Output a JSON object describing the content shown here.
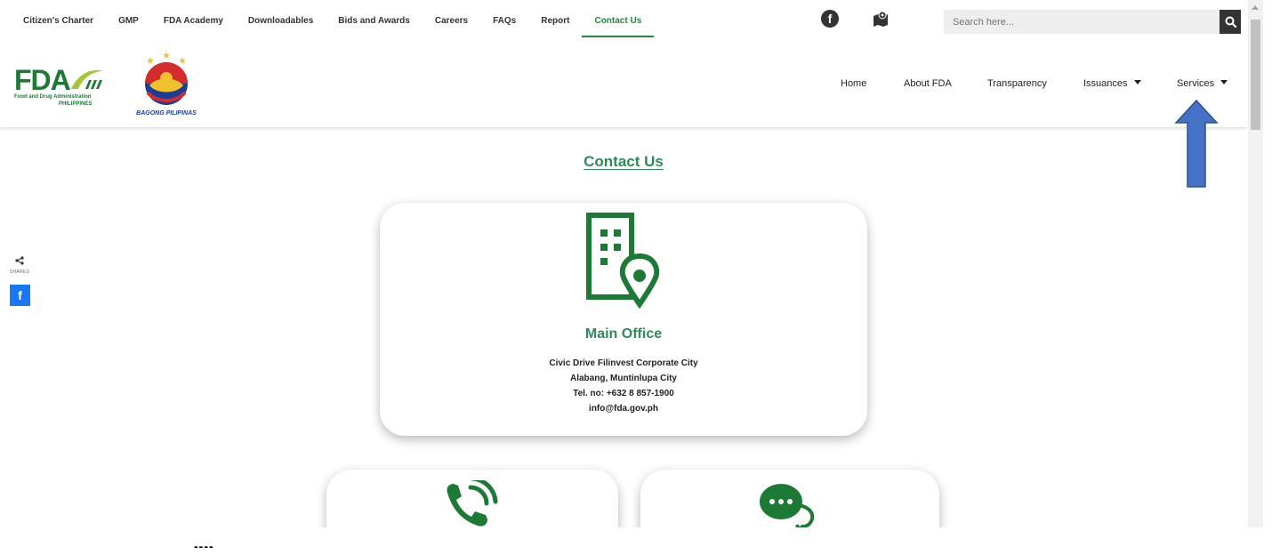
{
  "topnav": {
    "links": [
      {
        "label": "Citizen's Charter"
      },
      {
        "label": "GMP"
      },
      {
        "label": "FDA Academy"
      },
      {
        "label": "Downloadables"
      },
      {
        "label": "Bids and Awards"
      },
      {
        "label": "Careers"
      },
      {
        "label": "FAQs"
      },
      {
        "label": "Report"
      },
      {
        "label": "Contact Us",
        "active": true
      }
    ],
    "search_placeholder": "Search here...",
    "icons": [
      "facebook-icon",
      "map-icon",
      "search-icon"
    ]
  },
  "header": {
    "logo_fda": "FDA",
    "logo_fda_sub1": "Food and Drug Administration",
    "logo_fda_sub2": "PHILIPPINES",
    "logo_bagong": "BAGONG PILIPINAS",
    "nav": {
      "home": "Home",
      "about": "About FDA",
      "transparency": "Transparency",
      "issuances": "Issuances",
      "services": "Services"
    }
  },
  "share": {
    "label": "SHARES"
  },
  "page": {
    "title": "Contact Us",
    "main_office": {
      "title": "Main Office",
      "line1": "Civic Drive Filinvest Corporate City",
      "line2": "Alabang, Muntinlupa City",
      "line3": "Tel. no: +632 8 857-1900",
      "line4": "info@fda.gov.ph"
    }
  },
  "footer_marks": "----",
  "colors": {
    "brand_green": "#2e8b57",
    "dark_green": "#1d7a35",
    "arrow_blue": "#4472c4",
    "facebook": "#1877f2"
  }
}
